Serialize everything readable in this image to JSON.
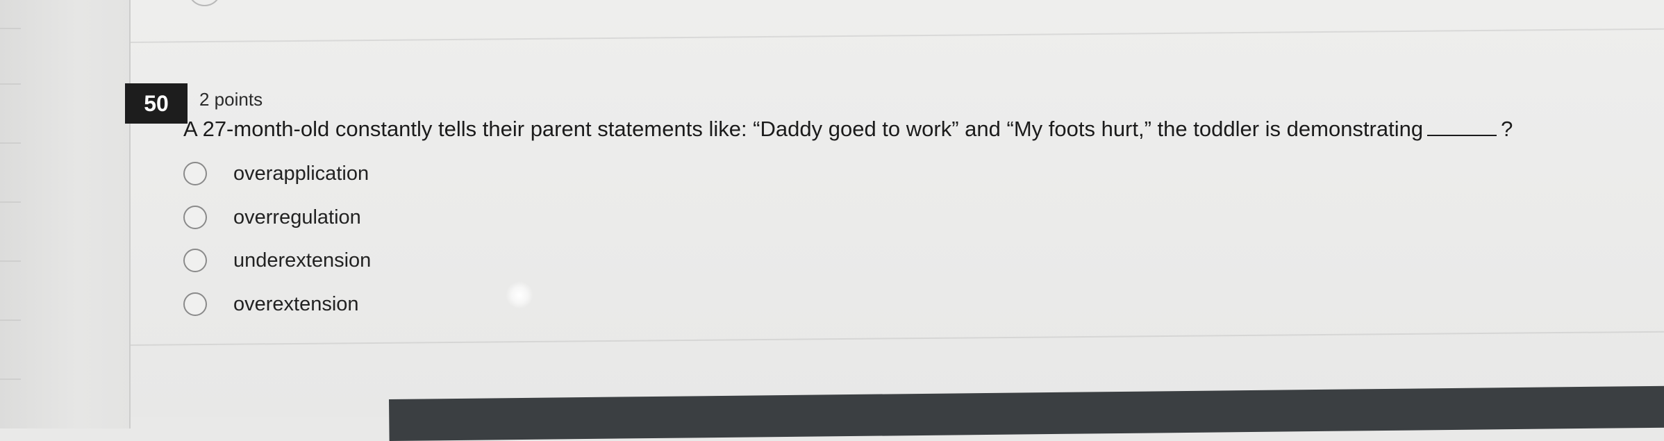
{
  "question": {
    "number": "50",
    "points": "2 points",
    "text_before_blank": "A 27-month-old constantly tells their parent statements like: “Daddy goed to work” and “My foots hurt,” the toddler is demonstrating",
    "text_after_blank": "?"
  },
  "options": [
    {
      "label": "overapplication",
      "selected": false
    },
    {
      "label": "overregulation",
      "selected": false
    },
    {
      "label": "underextension",
      "selected": false
    },
    {
      "label": "overextension",
      "selected": false
    }
  ]
}
